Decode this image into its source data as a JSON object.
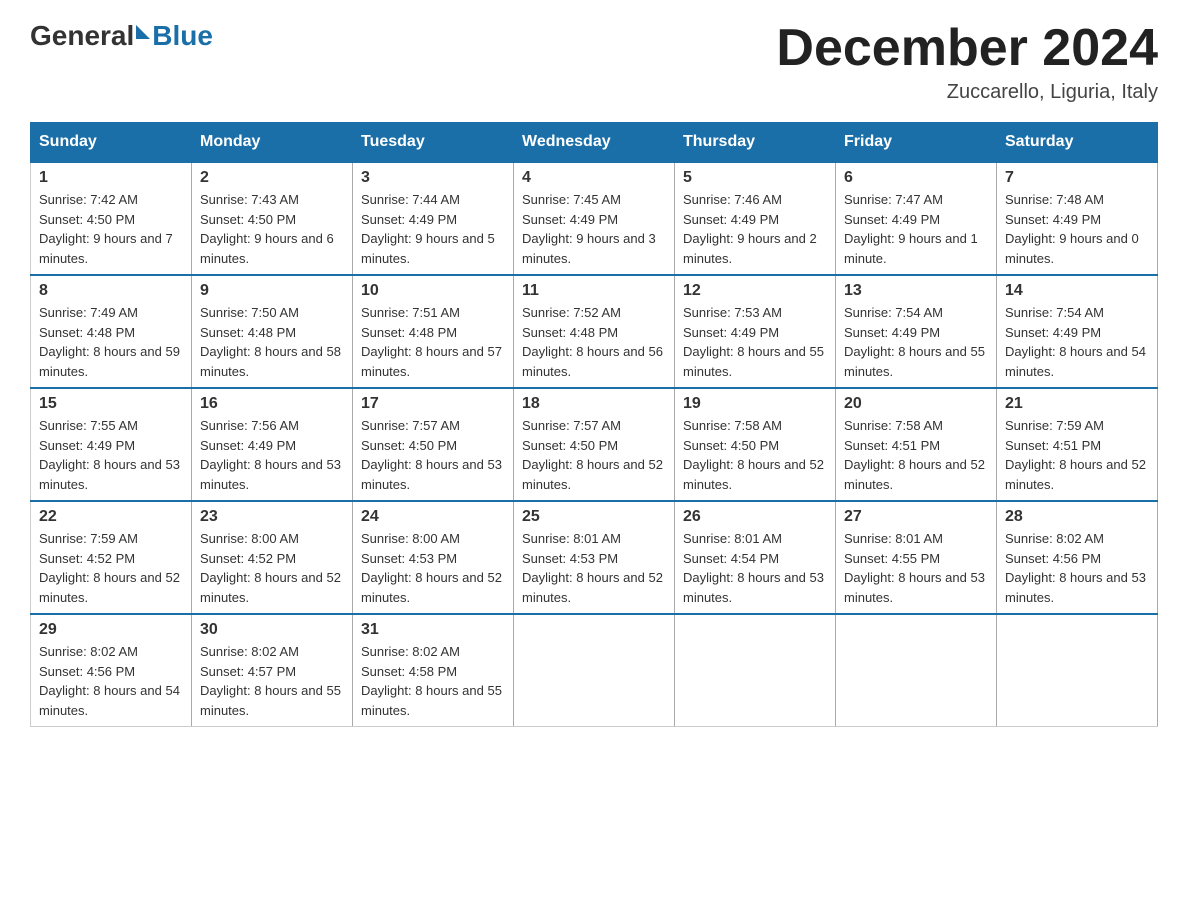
{
  "header": {
    "logo_general": "General",
    "logo_blue": "Blue",
    "month_title": "December 2024",
    "location": "Zuccarello, Liguria, Italy"
  },
  "days_of_week": [
    "Sunday",
    "Monday",
    "Tuesday",
    "Wednesday",
    "Thursday",
    "Friday",
    "Saturday"
  ],
  "weeks": [
    [
      {
        "day": "1",
        "sunrise": "7:42 AM",
        "sunset": "4:50 PM",
        "daylight": "9 hours and 7 minutes."
      },
      {
        "day": "2",
        "sunrise": "7:43 AM",
        "sunset": "4:50 PM",
        "daylight": "9 hours and 6 minutes."
      },
      {
        "day": "3",
        "sunrise": "7:44 AM",
        "sunset": "4:49 PM",
        "daylight": "9 hours and 5 minutes."
      },
      {
        "day": "4",
        "sunrise": "7:45 AM",
        "sunset": "4:49 PM",
        "daylight": "9 hours and 3 minutes."
      },
      {
        "day": "5",
        "sunrise": "7:46 AM",
        "sunset": "4:49 PM",
        "daylight": "9 hours and 2 minutes."
      },
      {
        "day": "6",
        "sunrise": "7:47 AM",
        "sunset": "4:49 PM",
        "daylight": "9 hours and 1 minute."
      },
      {
        "day": "7",
        "sunrise": "7:48 AM",
        "sunset": "4:49 PM",
        "daylight": "9 hours and 0 minutes."
      }
    ],
    [
      {
        "day": "8",
        "sunrise": "7:49 AM",
        "sunset": "4:48 PM",
        "daylight": "8 hours and 59 minutes."
      },
      {
        "day": "9",
        "sunrise": "7:50 AM",
        "sunset": "4:48 PM",
        "daylight": "8 hours and 58 minutes."
      },
      {
        "day": "10",
        "sunrise": "7:51 AM",
        "sunset": "4:48 PM",
        "daylight": "8 hours and 57 minutes."
      },
      {
        "day": "11",
        "sunrise": "7:52 AM",
        "sunset": "4:48 PM",
        "daylight": "8 hours and 56 minutes."
      },
      {
        "day": "12",
        "sunrise": "7:53 AM",
        "sunset": "4:49 PM",
        "daylight": "8 hours and 55 minutes."
      },
      {
        "day": "13",
        "sunrise": "7:54 AM",
        "sunset": "4:49 PM",
        "daylight": "8 hours and 55 minutes."
      },
      {
        "day": "14",
        "sunrise": "7:54 AM",
        "sunset": "4:49 PM",
        "daylight": "8 hours and 54 minutes."
      }
    ],
    [
      {
        "day": "15",
        "sunrise": "7:55 AM",
        "sunset": "4:49 PM",
        "daylight": "8 hours and 53 minutes."
      },
      {
        "day": "16",
        "sunrise": "7:56 AM",
        "sunset": "4:49 PM",
        "daylight": "8 hours and 53 minutes."
      },
      {
        "day": "17",
        "sunrise": "7:57 AM",
        "sunset": "4:50 PM",
        "daylight": "8 hours and 53 minutes."
      },
      {
        "day": "18",
        "sunrise": "7:57 AM",
        "sunset": "4:50 PM",
        "daylight": "8 hours and 52 minutes."
      },
      {
        "day": "19",
        "sunrise": "7:58 AM",
        "sunset": "4:50 PM",
        "daylight": "8 hours and 52 minutes."
      },
      {
        "day": "20",
        "sunrise": "7:58 AM",
        "sunset": "4:51 PM",
        "daylight": "8 hours and 52 minutes."
      },
      {
        "day": "21",
        "sunrise": "7:59 AM",
        "sunset": "4:51 PM",
        "daylight": "8 hours and 52 minutes."
      }
    ],
    [
      {
        "day": "22",
        "sunrise": "7:59 AM",
        "sunset": "4:52 PM",
        "daylight": "8 hours and 52 minutes."
      },
      {
        "day": "23",
        "sunrise": "8:00 AM",
        "sunset": "4:52 PM",
        "daylight": "8 hours and 52 minutes."
      },
      {
        "day": "24",
        "sunrise": "8:00 AM",
        "sunset": "4:53 PM",
        "daylight": "8 hours and 52 minutes."
      },
      {
        "day": "25",
        "sunrise": "8:01 AM",
        "sunset": "4:53 PM",
        "daylight": "8 hours and 52 minutes."
      },
      {
        "day": "26",
        "sunrise": "8:01 AM",
        "sunset": "4:54 PM",
        "daylight": "8 hours and 53 minutes."
      },
      {
        "day": "27",
        "sunrise": "8:01 AM",
        "sunset": "4:55 PM",
        "daylight": "8 hours and 53 minutes."
      },
      {
        "day": "28",
        "sunrise": "8:02 AM",
        "sunset": "4:56 PM",
        "daylight": "8 hours and 53 minutes."
      }
    ],
    [
      {
        "day": "29",
        "sunrise": "8:02 AM",
        "sunset": "4:56 PM",
        "daylight": "8 hours and 54 minutes."
      },
      {
        "day": "30",
        "sunrise": "8:02 AM",
        "sunset": "4:57 PM",
        "daylight": "8 hours and 55 minutes."
      },
      {
        "day": "31",
        "sunrise": "8:02 AM",
        "sunset": "4:58 PM",
        "daylight": "8 hours and 55 minutes."
      },
      null,
      null,
      null,
      null
    ]
  ]
}
